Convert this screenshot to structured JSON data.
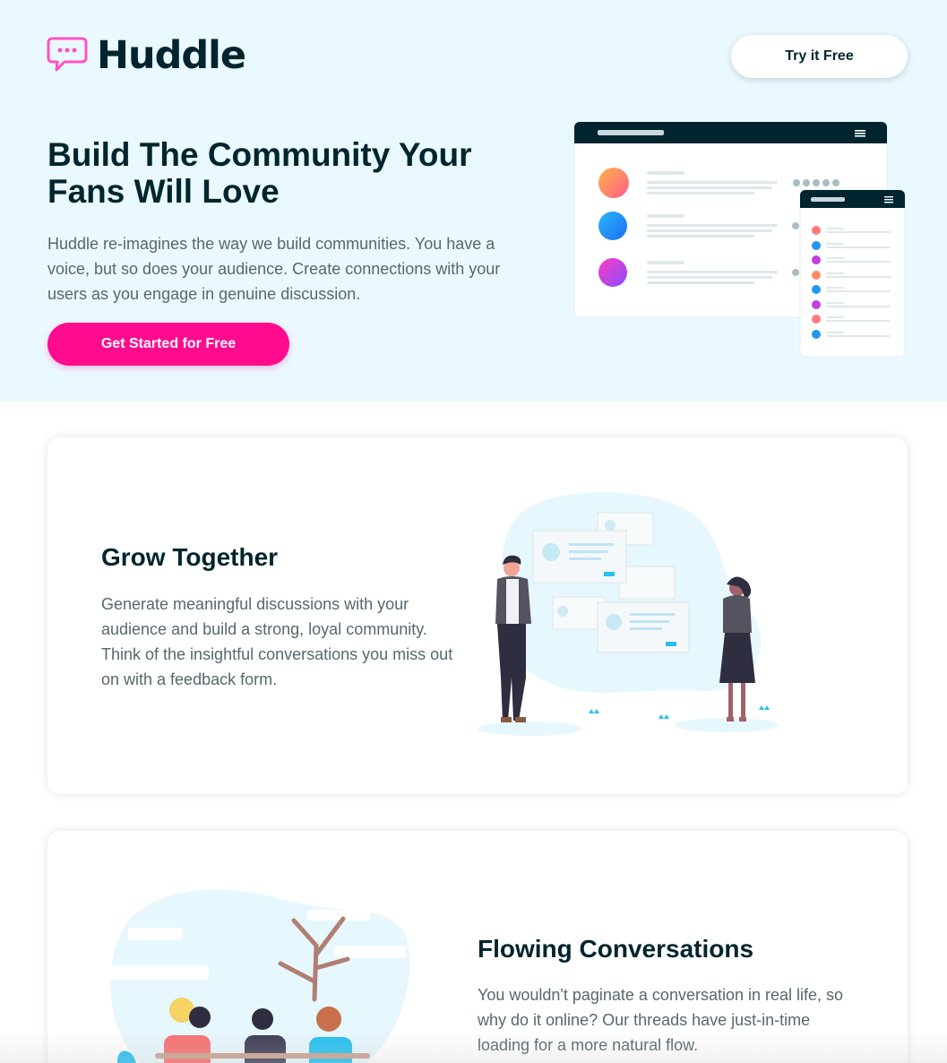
{
  "brand": {
    "name": "Huddle",
    "accent_color": "#ff0b8e",
    "text_color": "#00252e",
    "hero_bg_color": "#eaf9ff",
    "logo_icon": "chat-bubble-icon"
  },
  "header": {
    "try_button_label": "Try it Free"
  },
  "hero": {
    "title": "Build The Community Your Fans Will Love",
    "description": "Huddle re-imagines the way we build communities. You have a voice, but so does your audience. Create connections with your users as you engage in genuine discussion.",
    "cta_label": "Get Started for Free",
    "mockup_avatar_colors": [
      "#ff8a65",
      "#2196f3",
      "#c040e0"
    ]
  },
  "features": [
    {
      "title": "Grow Together",
      "text": "Generate meaningful discussions with your audience and build a strong, loyal community. Think of the insightful conversations you miss out on with a feedback form.",
      "illustration": "grow-together-illustration"
    },
    {
      "title": "Flowing Conversations",
      "text": "You wouldn't paginate a conversation in real life, so why do it online? Our threads have just-in-time loading for a more natural flow.",
      "illustration": "flowing-conversations-illustration"
    }
  ]
}
